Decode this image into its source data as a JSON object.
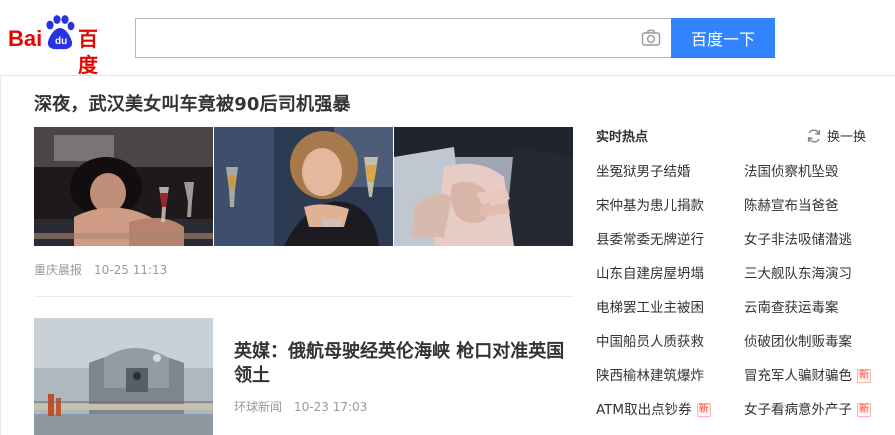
{
  "header": {
    "logo": {
      "latin": "Bai",
      "paw_text": "du",
      "chinese": "百度"
    },
    "search": {
      "value": "",
      "placeholder": ""
    },
    "search_button_label": "百度一下"
  },
  "news": [
    {
      "title": "深夜，武汉美女叫车竟被90后司机强暴",
      "source": "重庆晨报",
      "time": "10-25 11:13"
    },
    {
      "title": "英媒：俄航母驶经英伦海峡 枪口对准英国领土",
      "source": "环球新闻",
      "time": "10-23 17:03"
    }
  ],
  "hot": {
    "title": "实时热点",
    "refresh_label": "换一换",
    "new_badge": "新",
    "items": [
      {
        "label": "坐冤狱男子结婚",
        "new": false
      },
      {
        "label": "法国侦察机坠毁",
        "new": false
      },
      {
        "label": "宋仲基为患儿捐款",
        "new": false
      },
      {
        "label": "陈赫宣布当爸爸",
        "new": false
      },
      {
        "label": "县委常委无牌逆行",
        "new": false
      },
      {
        "label": "女子非法吸储潜逃",
        "new": false
      },
      {
        "label": "山东自建房屋坍塌",
        "new": false
      },
      {
        "label": "三大舰队东海演习",
        "new": false
      },
      {
        "label": "电梯罢工业主被困",
        "new": false
      },
      {
        "label": "云南查获运毒案",
        "new": false
      },
      {
        "label": "中国船员人质获救",
        "new": false
      },
      {
        "label": "侦破团伙制贩毒案",
        "new": false
      },
      {
        "label": "陕西榆林建筑爆炸",
        "new": false
      },
      {
        "label": "冒充军人骗财骗色",
        "new": true
      },
      {
        "label": "ATM取出点钞券",
        "new": true
      },
      {
        "label": "女子看病意外产子",
        "new": true
      }
    ]
  },
  "colors": {
    "brand_red": "#e10602",
    "brand_blue": "#2932e1",
    "button_blue": "#3385ff",
    "badge_red": "#ff4433"
  }
}
